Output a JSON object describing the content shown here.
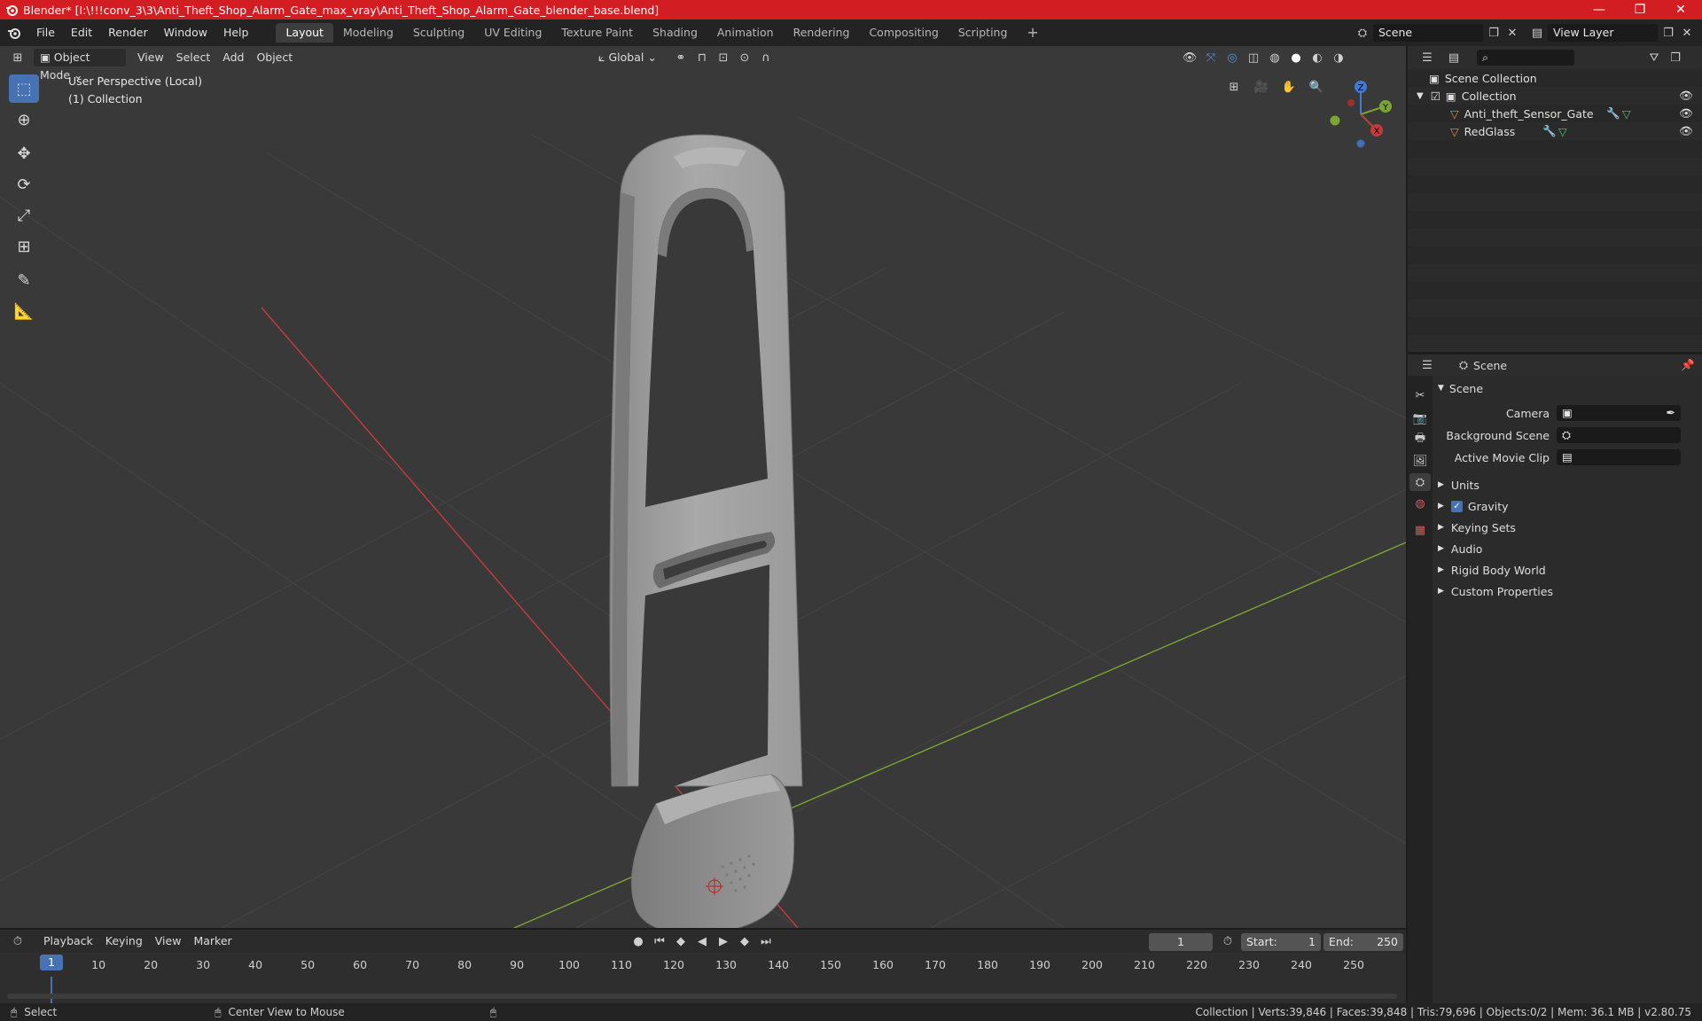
{
  "window": {
    "title": "Blender* [I:\\!!!conv_3\\3\\Anti_Theft_Shop_Alarm_Gate_max_vray\\Anti_Theft_Shop_Alarm_Gate_blender_base.blend]",
    "minimize": "—",
    "maximize": "❐",
    "close": "✕"
  },
  "menubar": {
    "items": [
      "File",
      "Edit",
      "Render",
      "Window",
      "Help"
    ],
    "workspaces": [
      "Layout",
      "Modeling",
      "Sculpting",
      "UV Editing",
      "Texture Paint",
      "Shading",
      "Animation",
      "Rendering",
      "Compositing",
      "Scripting"
    ],
    "active_workspace": "Layout",
    "add_workspace": "+",
    "scene": "Scene",
    "view_layer": "View Layer"
  },
  "viewport": {
    "mode": "Object Mode",
    "menus": [
      "View",
      "Select",
      "Add",
      "Object"
    ],
    "orientation": "Global",
    "info_line1": "User Perspective (Local)",
    "info_line2": "(1) Collection",
    "gizmo": {
      "x": "X",
      "y": "Y",
      "z": "Z"
    }
  },
  "outliner": {
    "search_placeholder": "",
    "scene_collection": "Scene Collection",
    "collection": "Collection",
    "objects": [
      "Anti_theft_Sensor_Gate",
      "RedGlass"
    ]
  },
  "properties": {
    "context": "Scene",
    "panel_scene": "Scene",
    "camera_label": "Camera",
    "background_scene_label": "Background Scene",
    "active_movie_clip_label": "Active Movie Clip",
    "panels": [
      "Units",
      "Gravity",
      "Keying Sets",
      "Audio",
      "Rigid Body World",
      "Custom Properties"
    ],
    "gravity_checked": true
  },
  "timeline": {
    "menus": [
      "Playback",
      "Keying",
      "View",
      "Marker"
    ],
    "current_frame": "1",
    "start_label": "Start:",
    "start": "1",
    "end_label": "End:",
    "end": "250",
    "ticks": [
      "1",
      "10",
      "20",
      "30",
      "40",
      "50",
      "60",
      "70",
      "80",
      "90",
      "100",
      "110",
      "120",
      "130",
      "140",
      "150",
      "160",
      "170",
      "180",
      "190",
      "200",
      "210",
      "220",
      "230",
      "240",
      "250"
    ]
  },
  "statusbar": {
    "select": "Select",
    "center": "Center View to Mouse",
    "stats": "Collection | Verts:39,846 | Faces:39,848 | Tris:79,696 | Objects:0/2 | Mem: 36.1 MB | v2.80.75"
  },
  "colors": {
    "titlebar": "#d21e23",
    "active_tool": "#4772b3",
    "axis_x": "#c83a3a",
    "axis_y": "#7aa531",
    "object_icon": "#e59035"
  }
}
